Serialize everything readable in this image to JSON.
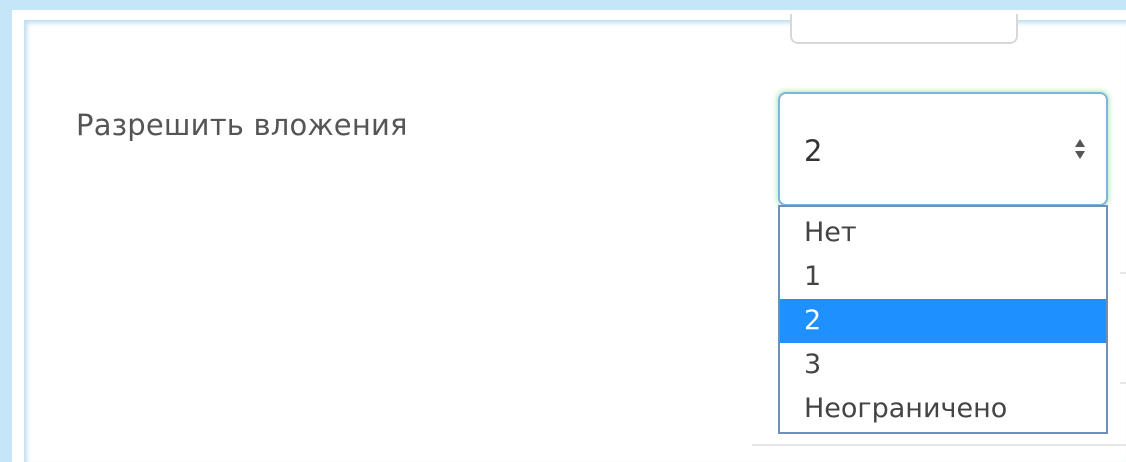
{
  "form": {
    "attachments_label": "Разрешить вложения",
    "attachments_select": {
      "value": "2",
      "options": [
        "Нет",
        "1",
        "2",
        "3",
        "Неограничено"
      ]
    }
  },
  "colors": {
    "frame": "#c4e6f8",
    "select_border": "#7fb3e0",
    "focus_glow": "#78dc82",
    "highlight": "#1e90ff"
  },
  "icons": {
    "select_arrows": "sort-arrows-icon"
  }
}
